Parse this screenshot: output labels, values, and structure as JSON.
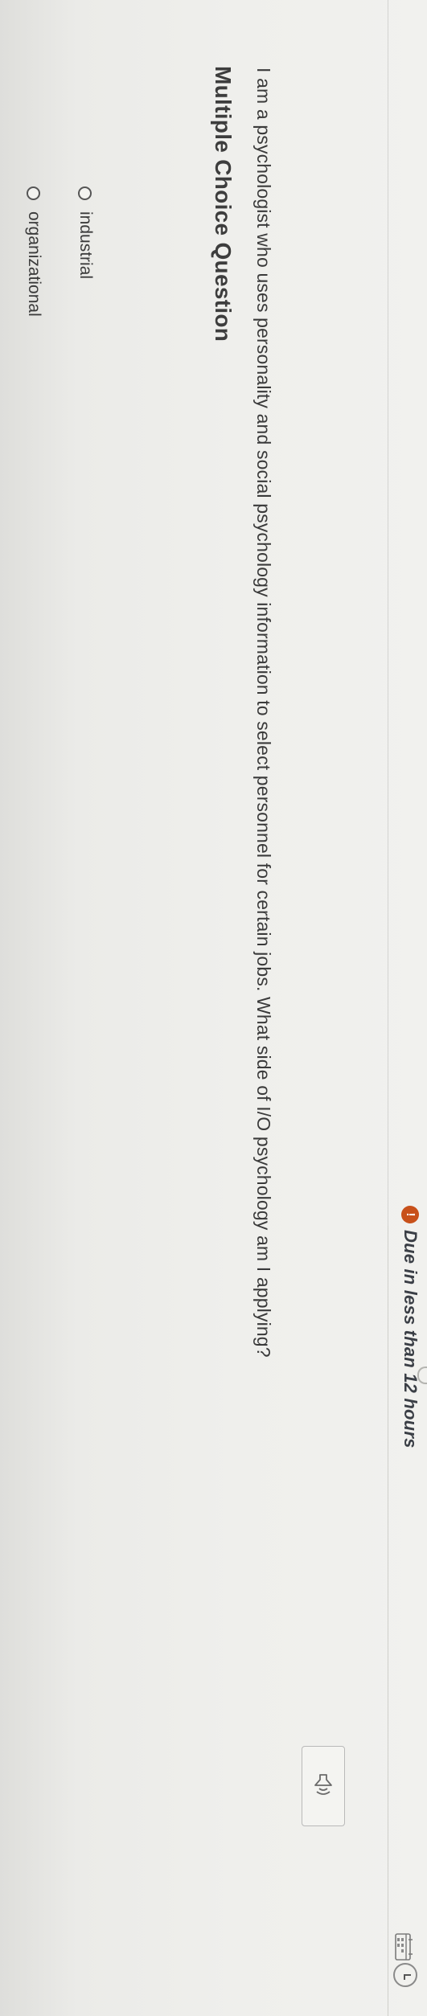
{
  "header": {
    "due_text": "Due in less than 12 hours",
    "due_icon": "!",
    "due_icon_color": "#c8511a"
  },
  "question": {
    "type_label": "Multiple Choice Question",
    "text": "I am a psychologist who uses personality and social psychology information to select personnel for certain jobs. What side of I/O psychology am I applying?"
  },
  "options": [
    {
      "label": "industrial"
    },
    {
      "label": "organizational"
    }
  ]
}
